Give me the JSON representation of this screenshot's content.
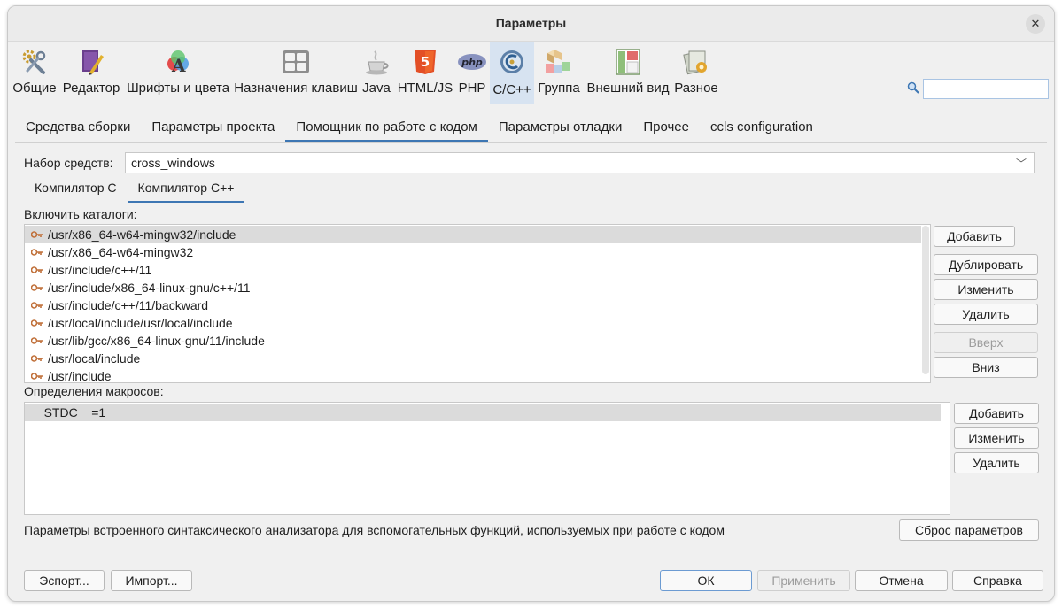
{
  "window": {
    "title": "Параметры",
    "close_glyph": "✕"
  },
  "toolbar": {
    "items": [
      {
        "label": "Общие",
        "icon": "general-settings-icon"
      },
      {
        "label": "Редактор",
        "icon": "editor-icon"
      },
      {
        "label": "Шрифты и цвета",
        "icon": "fonts-colors-icon"
      },
      {
        "label": "Назначения клавиш",
        "icon": "keymap-icon"
      },
      {
        "label": "Java",
        "icon": "java-icon"
      },
      {
        "label": "HTML/JS",
        "icon": "html5-icon"
      },
      {
        "label": "PHP",
        "icon": "php-icon"
      },
      {
        "label": "C/C++",
        "icon": "cpp-icon",
        "selected": true
      },
      {
        "label": "Группа",
        "icon": "group-icon"
      },
      {
        "label": "Внешний вид",
        "icon": "appearance-icon"
      },
      {
        "label": "Разное",
        "icon": "misc-icon"
      }
    ],
    "html5_text": "5",
    "php_text": "php",
    "search": {
      "value": "",
      "placeholder": ""
    }
  },
  "tabs": [
    {
      "label": "Средства сборки"
    },
    {
      "label": "Параметры проекта"
    },
    {
      "label": "Помощник по работе с кодом",
      "active": true
    },
    {
      "label": "Параметры отладки"
    },
    {
      "label": "Прочее"
    },
    {
      "label": "ccls configuration"
    }
  ],
  "toolset": {
    "label": "Набор средств:",
    "value": "cross_windows",
    "chevron": "﹀"
  },
  "subtabs": [
    {
      "label": "Компилятор C"
    },
    {
      "label": "Компилятор C++",
      "active": true
    }
  ],
  "include_dirs": {
    "label": "Включить каталоги:",
    "items": [
      "/usr/x86_64-w64-mingw32/include",
      "/usr/x86_64-w64-mingw32",
      "/usr/include/c++/11",
      "/usr/include/x86_64-linux-gnu/c++/11",
      "/usr/include/c++/11/backward",
      "/usr/local/include/usr/local/include",
      "/usr/lib/gcc/x86_64-linux-gnu/11/include",
      "/usr/local/include",
      "/usr/include"
    ],
    "buttons": {
      "add": "Добавить",
      "duplicate": "Дублировать",
      "edit": "Изменить",
      "delete": "Удалить",
      "up": "Вверх",
      "down": "Вниз"
    }
  },
  "macros": {
    "label": "Определения макросов:",
    "items": [
      "__STDC__=1"
    ],
    "buttons": {
      "add": "Добавить",
      "edit": "Изменить",
      "delete": "Удалить"
    }
  },
  "parser": {
    "text": "Параметры встроенного синтаксического анализатора для вспомогательных функций, используемых при работе с кодом",
    "reset_button": "Сброс параметров"
  },
  "footer": {
    "export": "Эспорт...",
    "import": "Импорт...",
    "ok": "ОК",
    "apply": "Применить",
    "cancel": "Отмена",
    "help": "Справка"
  },
  "colors": {
    "accent": "#3d76b3",
    "selected_toolbar": "#d7e3f1",
    "selection_row": "#dbdbdb"
  }
}
